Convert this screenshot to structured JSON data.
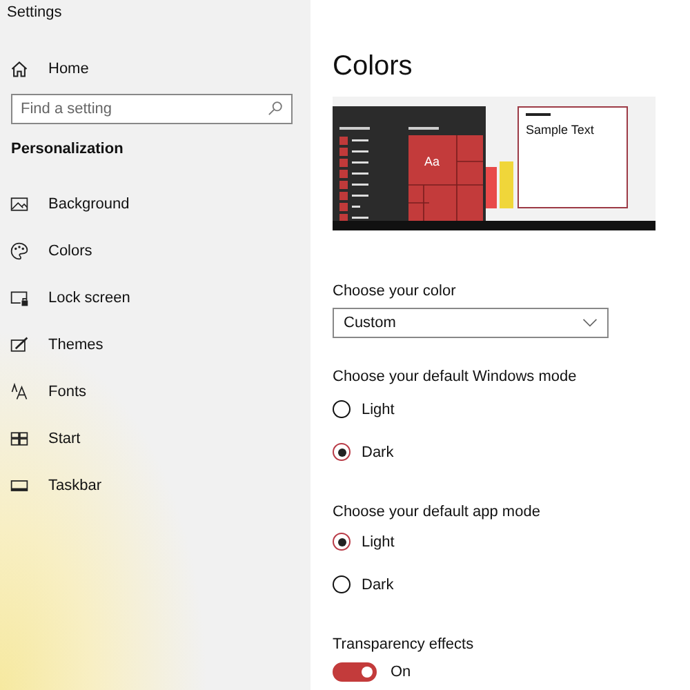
{
  "window": {
    "title": "Settings"
  },
  "sidebar": {
    "home": "Home",
    "search": {
      "placeholder": "Find a setting"
    },
    "section": "Personalization",
    "items": [
      {
        "label": "Background"
      },
      {
        "label": "Colors"
      },
      {
        "label": "Lock screen"
      },
      {
        "label": "Themes"
      },
      {
        "label": "Fonts"
      },
      {
        "label": "Start"
      },
      {
        "label": "Taskbar"
      }
    ]
  },
  "page": {
    "title": "Colors",
    "preview": {
      "tile_text": "Aa",
      "sample_text": "Sample Text"
    },
    "color_label": "Choose your color",
    "color_value": "Custom",
    "groups": [
      {
        "label": "Choose your default Windows mode",
        "options": [
          {
            "label": "Light",
            "selected": false
          },
          {
            "label": "Dark",
            "selected": true
          }
        ]
      },
      {
        "label": "Choose your default app mode",
        "options": [
          {
            "label": "Light",
            "selected": true
          },
          {
            "label": "Dark",
            "selected": false
          }
        ]
      }
    ],
    "transparency": {
      "label": "Transparency effects",
      "on": true,
      "state_text": "On"
    }
  }
}
